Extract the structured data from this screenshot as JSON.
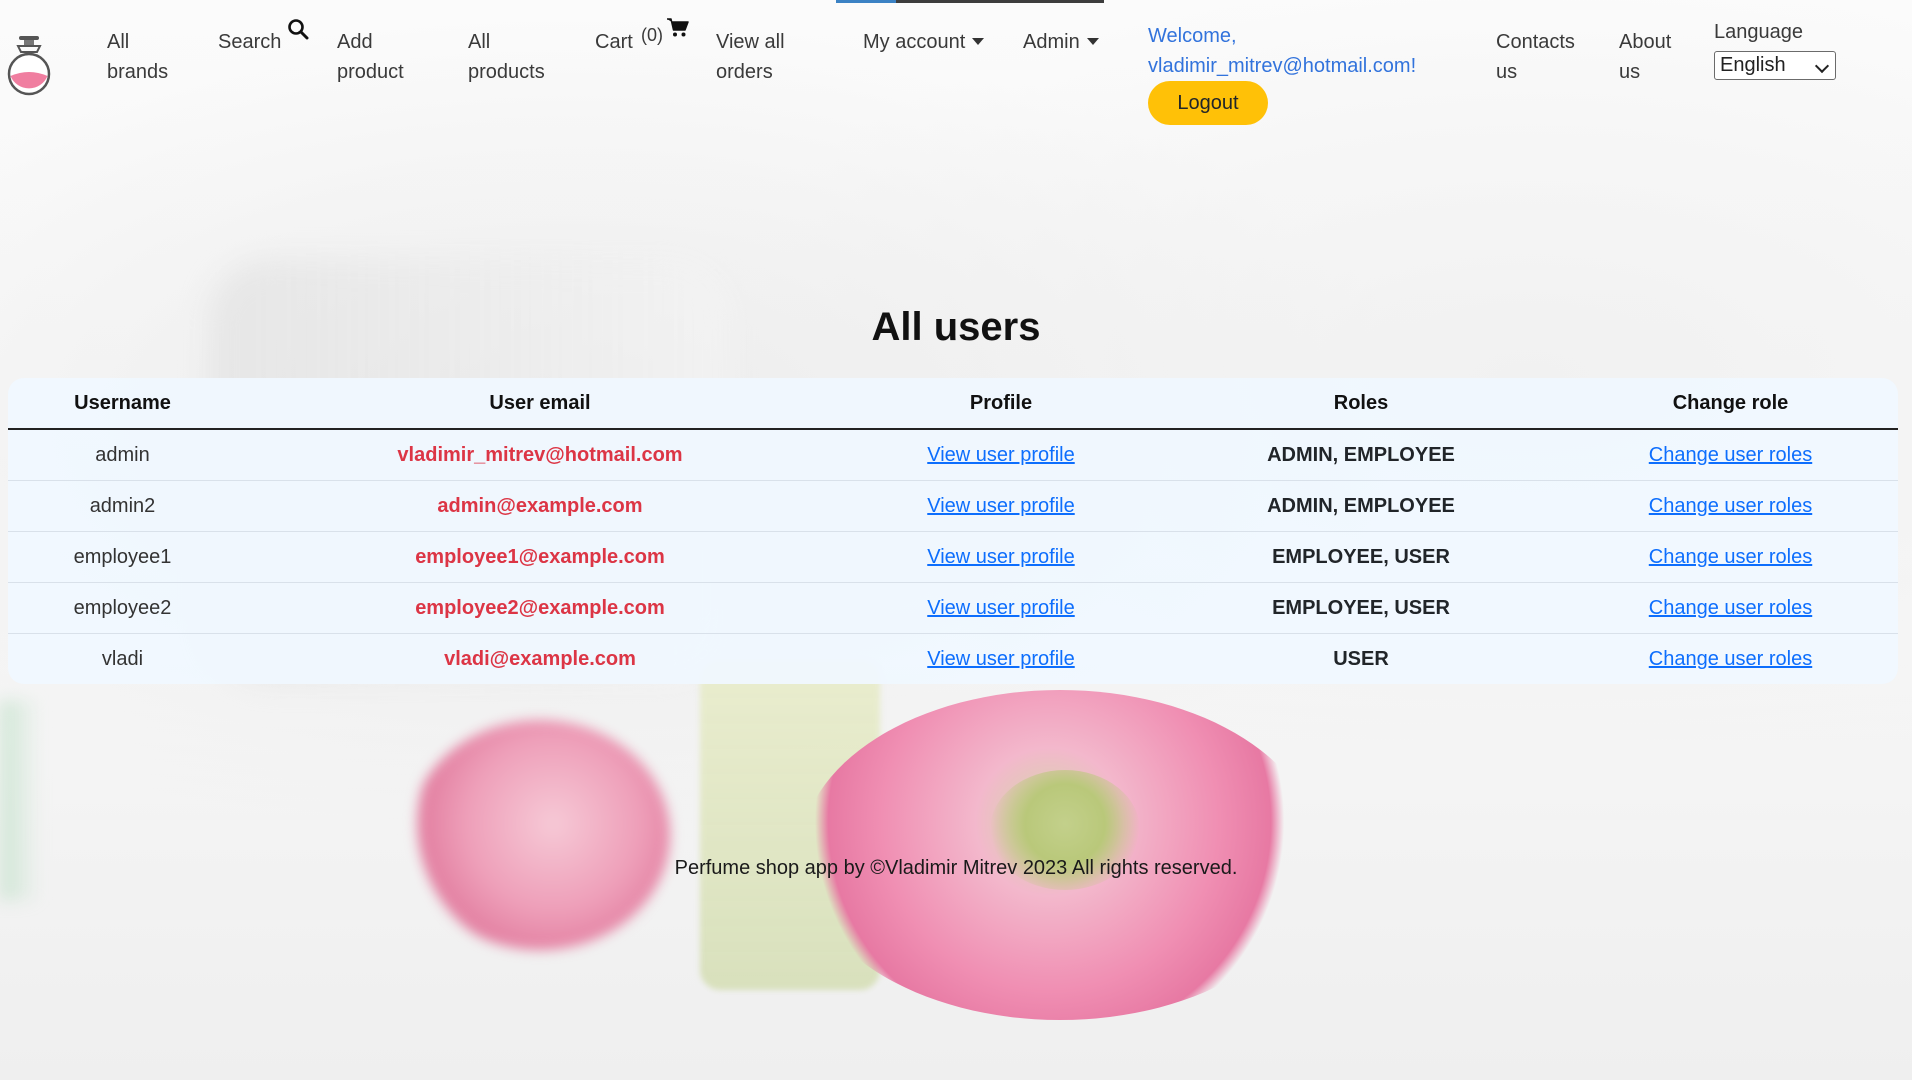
{
  "nav": {
    "all_brands": [
      "All",
      "brands"
    ],
    "search": "Search",
    "add_product": [
      "Add",
      "product"
    ],
    "all_products": [
      "All",
      "products"
    ],
    "cart": "Cart",
    "cart_count": "(0)",
    "view_all_orders": [
      "View all",
      "orders"
    ],
    "my_account": "My account",
    "admin": "Admin",
    "welcome": [
      "Welcome,",
      "vladimir_mitrev@hotmail.com!"
    ],
    "logout": "Logout",
    "contacts_us": [
      "Contacts",
      "us"
    ],
    "about_us": [
      "About",
      "us"
    ],
    "language_label": "Language",
    "language_selected": "English"
  },
  "page": {
    "title": "All users"
  },
  "table": {
    "headers": [
      "Username",
      "User email",
      "Profile",
      "Roles",
      "Change role"
    ],
    "rows": [
      {
        "username": "admin",
        "email": "vladimir_mitrev@hotmail.com",
        "profile": "View user profile",
        "roles": "ADMIN, EMPLOYEE",
        "change": "Change user roles"
      },
      {
        "username": "admin2",
        "email": "admin@example.com",
        "profile": "View user profile",
        "roles": "ADMIN, EMPLOYEE",
        "change": "Change user roles"
      },
      {
        "username": "employee1",
        "email": "employee1@example.com",
        "profile": "View user profile",
        "roles": "EMPLOYEE, USER",
        "change": "Change user roles"
      },
      {
        "username": "employee2",
        "email": "employee2@example.com",
        "profile": "View user profile",
        "roles": "EMPLOYEE, USER",
        "change": "Change user roles"
      },
      {
        "username": "vladi",
        "email": "vladi@example.com",
        "profile": "View user profile",
        "roles": "USER",
        "change": "Change user roles"
      }
    ]
  },
  "footer": {
    "text": "Perfume shop app by ©Vladimir Mitrev 2023 All rights reserved."
  },
  "colors": {
    "accent_yellow": "#ffc107",
    "link_blue": "#0d6efd",
    "email_red": "#dc3545",
    "welcome_blue": "#3273dc"
  }
}
